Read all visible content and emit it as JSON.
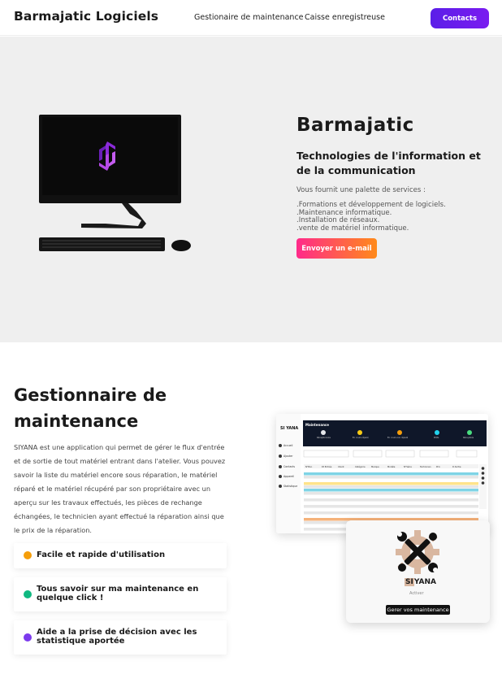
{
  "nav": {
    "brand": "Barmajatic Logiciels",
    "links": [
      "Gestionaire de maintenance",
      "Caisse enregistreuse"
    ],
    "contacts_label": "Contacts"
  },
  "hero": {
    "title": "Barmajatic",
    "subtitle": "Technologies de l'information et de la communication",
    "intro": "Vous fournit une palette de services :",
    "services": [
      ".Formations et développement de logiciels.",
      ".Maintenance informatique.",
      ".Installation de réseaux.",
      ".vente de matériel informatique."
    ],
    "email_button": "Envoyer un e-mail"
  },
  "maintenance": {
    "title": "Gestionnaire de maintenance",
    "description": "SIYANA est une application qui permet de gérer le flux d'entrée et de sortie de tout matériel entrant dans l'atelier. Vous pouvez savoir la liste du matériel encore sous réparation, le matériel réparé et le matériel récupéré par son propriétaire avec un aperçu sur les travaux effectués, les pièces de rechange échangées, le technicien ayant effectué la réparation ainsi que le prix de la réparation.",
    "features": [
      {
        "label": "Facile et rapide d'utilisation",
        "color": "#f59e0b"
      },
      {
        "label": "Tous savoir sur ma maintenance en quelque click !",
        "color": "#10b981"
      },
      {
        "label": "Aide a la prise de décision avec les statistique aportée",
        "color": "#7c3aed"
      }
    ]
  },
  "app_preview": {
    "window_title": "Maintenance",
    "sidebar": [
      "Accueil",
      "Ajouter",
      "Contacts",
      "Apparell",
      "Statistique"
    ],
    "status_labels": [
      "Réceptionnés",
      "En cours réparé",
      "En cours non réparé",
      "Prêts",
      "Récupérés"
    ],
    "status_counts": [
      "24",
      "6",
      "2",
      "14",
      "6"
    ],
    "columns": [
      "N°Bon",
      "Dt Entrée",
      "Client",
      "Catégorie",
      "Marque",
      "Modèle",
      "N°Série",
      "Technicien",
      "Prix",
      "D.Sortie"
    ],
    "row_count": 20,
    "colors": {
      "header_dark": "#0f1729",
      "row_blue": "#7fd4e6",
      "row_yellow": "#ffe38a",
      "row_orange": "#f5b27a",
      "row_grey": "#e6e6e6"
    }
  },
  "siyana": {
    "brand_si": "SI",
    "brand_rest": "YANA",
    "activate_label": "Activer",
    "manage_button": "Gerer vos maintenance"
  },
  "colors": {
    "contacts_gradient": [
      "#5b1ee8",
      "#7a1cf0"
    ],
    "email_gradient": [
      "#ff2a8a",
      "#ff8a1a"
    ],
    "hero_bg": "#efefef",
    "logo_purple": "#8b2bd9"
  }
}
